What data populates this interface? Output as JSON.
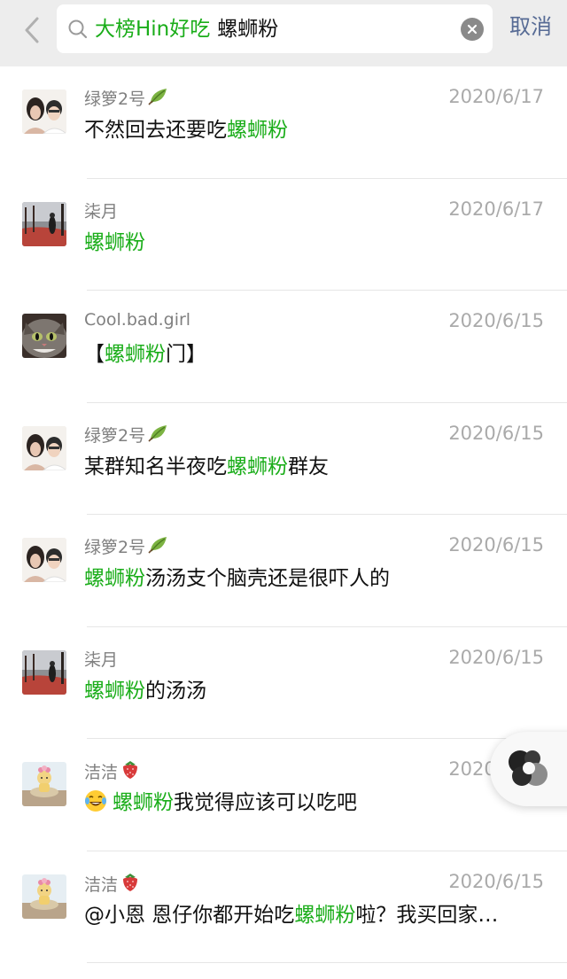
{
  "header": {
    "search_tag": "大榜Hin好吃",
    "search_keyword": "螺蛳粉",
    "cancel_label": "取消"
  },
  "results": [
    {
      "name": "绿箩2号",
      "badge": "leaf",
      "date": "2020/6/17",
      "avatar": "couple",
      "msg_before": "不然回去还要吃",
      "msg_highlight": "螺蛳粉",
      "msg_after": ""
    },
    {
      "name": "柒月",
      "badge": "",
      "date": "2020/6/17",
      "avatar": "autumn",
      "msg_before": "",
      "msg_highlight": "螺蛳粉",
      "msg_after": ""
    },
    {
      "name": "Cool.bad.girl",
      "badge": "",
      "date": "2020/6/15",
      "avatar": "cat",
      "msg_before": "【",
      "msg_highlight": "螺蛳粉",
      "msg_after": "门】"
    },
    {
      "name": "绿箩2号",
      "badge": "leaf",
      "date": "2020/6/15",
      "avatar": "couple",
      "msg_before": "某群知名半夜吃",
      "msg_highlight": "螺蛳粉",
      "msg_after": "群友"
    },
    {
      "name": "绿箩2号",
      "badge": "leaf",
      "date": "2020/6/15",
      "avatar": "couple",
      "msg_before": "",
      "msg_highlight": "螺蛳粉",
      "msg_after": "汤汤支个脑壳还是很吓人的"
    },
    {
      "name": "柒月",
      "badge": "",
      "date": "2020/6/15",
      "avatar": "autumn",
      "msg_before": "",
      "msg_highlight": "螺蛳粉",
      "msg_after": "的汤汤"
    },
    {
      "name": "洁洁",
      "badge": "strawberry",
      "date": "2020/6/15",
      "avatar": "figure",
      "msg_emoji": "laughing-tears",
      "msg_before": "",
      "msg_highlight": "螺蛳粉",
      "msg_after": "我觉得应该可以吃吧"
    },
    {
      "name": "洁洁",
      "badge": "strawberry",
      "date": "2020/6/15",
      "avatar": "figure",
      "msg_before": "@小恩 恩仔你都开始吃",
      "msg_highlight": "螺蛳粉",
      "msg_after": "啦？我买回家…"
    }
  ],
  "colors": {
    "highlight": "#1aad19",
    "link": "#576b95",
    "header_bg": "#ededed"
  }
}
